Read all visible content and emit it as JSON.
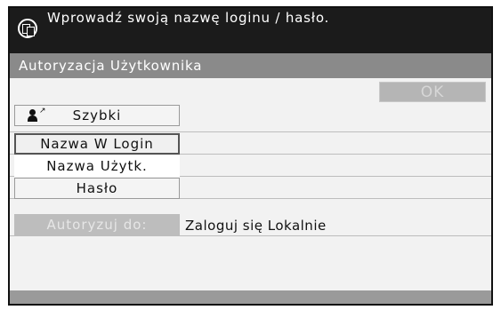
{
  "header": {
    "message": "Wprowadź swoją nazwę loginu / hasło.",
    "icon": "copy-pages-icon"
  },
  "titlebar": {
    "title": "Autoryzacja Użytkownika"
  },
  "ok_button": {
    "label": "OK"
  },
  "buttons": {
    "quick": {
      "label": "Szybki",
      "icon": "person-arrow-icon"
    },
    "login_name": {
      "label": "Nazwa W Login"
    },
    "user_name": {
      "label": "Nazwa Użytk."
    },
    "password": {
      "label": "Hasło"
    },
    "authorize_to": {
      "label": "Autoryzuj do:"
    }
  },
  "authorize_value": "Zaloguj się Lokalnie"
}
